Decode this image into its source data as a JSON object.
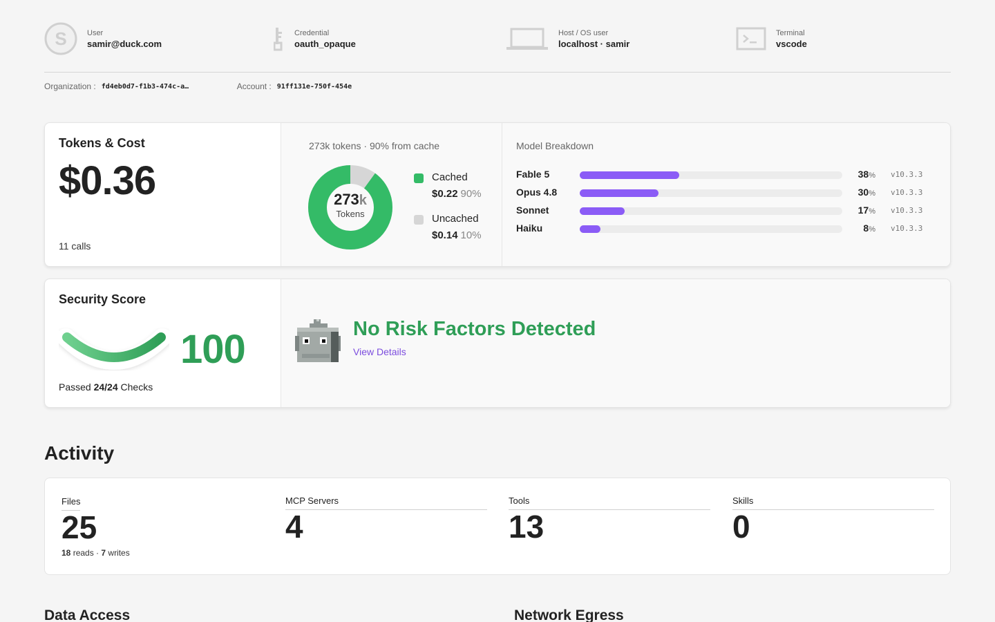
{
  "header": {
    "user": {
      "label": "User",
      "value": "samir@duck.com",
      "avatar_letter": "S"
    },
    "credential": {
      "label": "Credential",
      "value": "oauth_opaque"
    },
    "host": {
      "label": "Host / OS user",
      "value": "localhost · samir"
    },
    "terminal": {
      "label": "Terminal",
      "value": "vscode"
    },
    "organization": {
      "label": "Organization :",
      "value": "fd4eb0d7-f1b3-474c-a…"
    },
    "account": {
      "label": "Account :",
      "value": "91ff131e-750f-454e"
    }
  },
  "tokens_cost": {
    "title": "Tokens & Cost",
    "cost": "$0.36",
    "calls": "11 calls",
    "summary": "273k tokens · 90% from cache",
    "donut_number": "273",
    "donut_unit": "k",
    "donut_label": "Tokens",
    "cached": {
      "label": "Cached",
      "value": "$0.22",
      "pct": "90%",
      "fraction": 0.9,
      "color": "#34bb67"
    },
    "uncached": {
      "label": "Uncached",
      "value": "$0.14",
      "pct": "10%",
      "fraction": 0.1,
      "color": "#d6d6d6"
    }
  },
  "model_breakdown": {
    "title": "Model Breakdown",
    "bar_color": "#8b5cf6",
    "models": [
      {
        "name": "Fable 5",
        "pct": 38,
        "pct_sign": "%",
        "version": "v10.3.3"
      },
      {
        "name": "Opus 4.8",
        "pct": 30,
        "pct_sign": "%",
        "version": "v10.3.3"
      },
      {
        "name": "Sonnet",
        "pct": 17,
        "pct_sign": "%",
        "version": "v10.3.3"
      },
      {
        "name": "Haiku",
        "pct": 8,
        "pct_sign": "%",
        "version": "v10.3.3"
      }
    ]
  },
  "security": {
    "title": "Security Score",
    "score": "100",
    "passed_prefix": "Passed ",
    "passed_count": "24/24",
    "passed_suffix": " Checks",
    "risk_title": "No Risk Factors Detected",
    "details_link": "View Details",
    "color": "#2f9e57"
  },
  "activity": {
    "title": "Activity",
    "files": {
      "label": "Files",
      "value": "25",
      "reads": "18",
      "reads_label": " reads · ",
      "writes": "7",
      "writes_label": " writes"
    },
    "mcp": {
      "label": "MCP Servers",
      "value": "4"
    },
    "tools": {
      "label": "Tools",
      "value": "13"
    },
    "skills": {
      "label": "Skills",
      "value": "0"
    }
  },
  "sections": {
    "data_access": "Data Access",
    "network_egress": "Network Egress"
  }
}
